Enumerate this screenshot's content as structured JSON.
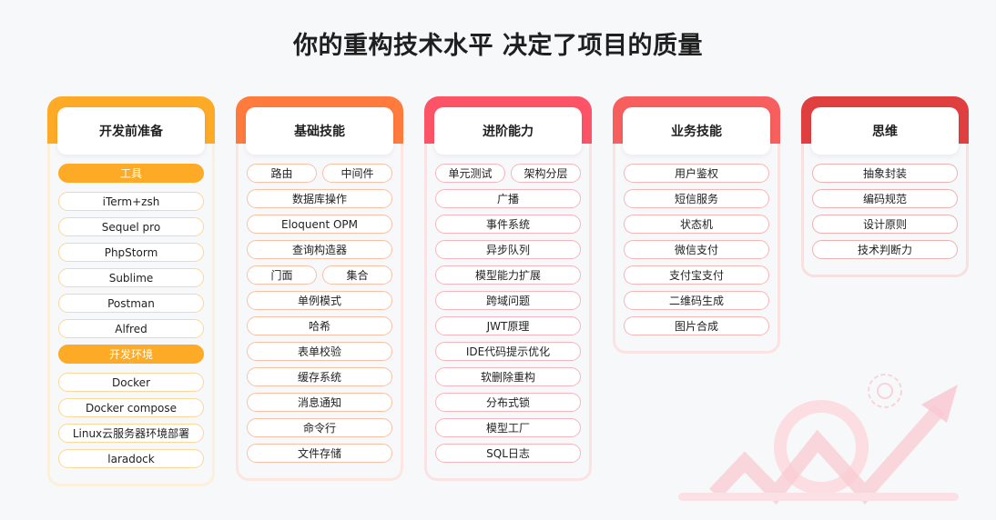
{
  "title": "你的重构技术水平 决定了项目的质量",
  "colors": {
    "col1": "#fdab26",
    "col2": "#ff7a3d",
    "col3": "#fc5466",
    "col4": "#f75f5e",
    "col5": "#e03f40",
    "background": "#f7f8fa"
  },
  "columns": [
    {
      "title": "开发前准备",
      "rows": [
        [
          "工具"
        ],
        [
          "iTerm+zsh"
        ],
        [
          "Sequel pro"
        ],
        [
          "PhpStorm"
        ],
        [
          "Sublime"
        ],
        [
          "Postman"
        ],
        [
          "Alfred"
        ],
        [
          "开发环境"
        ],
        [
          "Docker"
        ],
        [
          "Docker compose"
        ],
        [
          "Linux云服务器环境部署"
        ],
        [
          "laradock"
        ]
      ],
      "section_headers": [
        "工具",
        "开发环境"
      ]
    },
    {
      "title": "基础技能",
      "rows": [
        [
          "路由",
          "中间件"
        ],
        [
          "数据库操作"
        ],
        [
          "Eloquent OPM"
        ],
        [
          "查询构造器"
        ],
        [
          "门面",
          "集合"
        ],
        [
          "单例模式"
        ],
        [
          "哈希"
        ],
        [
          "表单校验"
        ],
        [
          "缓存系统"
        ],
        [
          "消息通知"
        ],
        [
          "命令行"
        ],
        [
          "文件存储"
        ]
      ]
    },
    {
      "title": "进阶能力",
      "rows": [
        [
          "单元测试",
          "架构分层"
        ],
        [
          "广播"
        ],
        [
          "事件系统"
        ],
        [
          "异步队列"
        ],
        [
          "模型能力扩展"
        ],
        [
          "跨域问题"
        ],
        [
          "JWT原理"
        ],
        [
          "IDE代码提示优化"
        ],
        [
          "软删除重构"
        ],
        [
          "分布式锁"
        ],
        [
          "模型工厂"
        ],
        [
          "SQL日志"
        ]
      ]
    },
    {
      "title": "业务技能",
      "rows": [
        [
          "用户鉴权"
        ],
        [
          "短信服务"
        ],
        [
          "状态机"
        ],
        [
          "微信支付"
        ],
        [
          "支付宝支付"
        ],
        [
          "二维码生成"
        ],
        [
          "图片合成"
        ]
      ]
    },
    {
      "title": "思维",
      "rows": [
        [
          "抽象封装"
        ],
        [
          "编码规范"
        ],
        [
          "设计原则"
        ],
        [
          "技术判断力"
        ]
      ]
    }
  ],
  "decoration": {
    "icons": [
      "growth-arrow-icon",
      "gear-icon",
      "donut-icon"
    ]
  }
}
